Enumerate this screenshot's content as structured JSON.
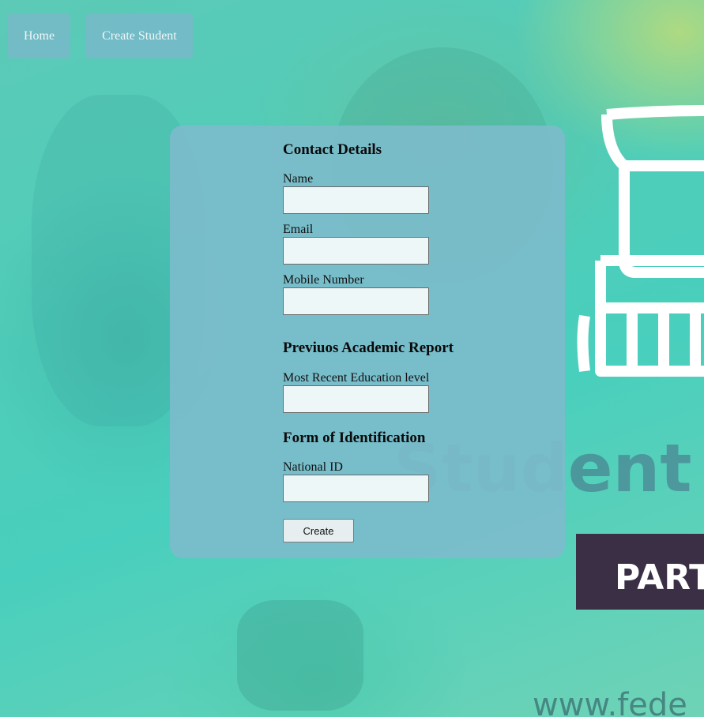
{
  "nav": {
    "home_label": "Home",
    "create_student_label": "Create Student"
  },
  "form": {
    "contact_title": "Contact Details",
    "name_label": "Name",
    "name_value": "",
    "email_label": "Email",
    "email_value": "",
    "mobile_label": "Mobile Number",
    "mobile_value": "",
    "academic_title": "Previuos Academic Report",
    "education_label": "Most Recent Education level",
    "education_value": "",
    "identification_title": "Form of Identification",
    "national_id_label": "National ID",
    "national_id_value": "",
    "create_label": "Create"
  },
  "background": {
    "word_student": "Student",
    "word_part": "PART",
    "url_text": "www.fede"
  },
  "colors": {
    "background_teal": "#4fcdb9",
    "card_blue": "#7cbccb",
    "nav_button": "#78b9c8",
    "poster_dark": "#3a2f45"
  }
}
